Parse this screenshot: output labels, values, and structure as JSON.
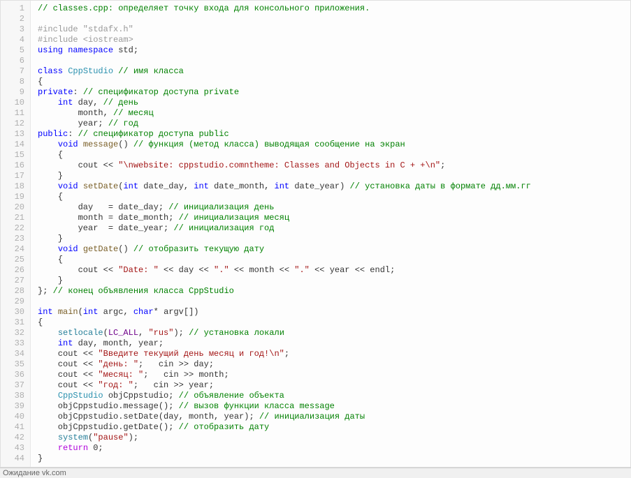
{
  "status_bar": "Ожидание vk.com",
  "lines": [
    [
      {
        "cls": "c-comment",
        "t": "// classes.cpp: определяет точку входа для консольного приложения."
      }
    ],
    [],
    [
      {
        "cls": "c-pp",
        "t": "#include \"stdafx.h\""
      }
    ],
    [
      {
        "cls": "c-pp",
        "t": "#include <iostream>"
      }
    ],
    [
      {
        "cls": "c-keyword",
        "t": "using"
      },
      {
        "cls": "c-plain",
        "t": " "
      },
      {
        "cls": "c-keyword",
        "t": "namespace"
      },
      {
        "cls": "c-plain",
        "t": " std;"
      }
    ],
    [],
    [
      {
        "cls": "c-keyword",
        "t": "class"
      },
      {
        "cls": "c-plain",
        "t": " "
      },
      {
        "cls": "c-type",
        "t": "CppStudio"
      },
      {
        "cls": "c-plain",
        "t": " "
      },
      {
        "cls": "c-comment",
        "t": "// имя класса"
      }
    ],
    [
      {
        "cls": "c-plain",
        "t": "{"
      }
    ],
    [
      {
        "cls": "c-keyword",
        "t": "private"
      },
      {
        "cls": "c-plain",
        "t": ": "
      },
      {
        "cls": "c-comment",
        "t": "// спецификатор доступа private"
      }
    ],
    [
      {
        "cls": "c-plain",
        "t": "    "
      },
      {
        "cls": "c-keyword",
        "t": "int"
      },
      {
        "cls": "c-plain",
        "t": " day, "
      },
      {
        "cls": "c-comment",
        "t": "// день"
      }
    ],
    [
      {
        "cls": "c-plain",
        "t": "        month, "
      },
      {
        "cls": "c-comment",
        "t": "// месяц"
      }
    ],
    [
      {
        "cls": "c-plain",
        "t": "        year; "
      },
      {
        "cls": "c-comment",
        "t": "// год"
      }
    ],
    [
      {
        "cls": "c-keyword",
        "t": "public"
      },
      {
        "cls": "c-plain",
        "t": ": "
      },
      {
        "cls": "c-comment",
        "t": "// спецификатор доступа public"
      }
    ],
    [
      {
        "cls": "c-plain",
        "t": "    "
      },
      {
        "cls": "c-keyword",
        "t": "void"
      },
      {
        "cls": "c-plain",
        "t": " "
      },
      {
        "cls": "c-func",
        "t": "message"
      },
      {
        "cls": "c-plain",
        "t": "() "
      },
      {
        "cls": "c-comment",
        "t": "// функция (метод класса) выводящая сообщение на экран"
      }
    ],
    [
      {
        "cls": "c-plain",
        "t": "    {"
      }
    ],
    [
      {
        "cls": "c-plain",
        "t": "        cout << "
      },
      {
        "cls": "c-string",
        "t": "\"\\nwebsite: cppstudio.comntheme: Classes and Objects in C + +\\n\""
      },
      {
        "cls": "c-plain",
        "t": ";"
      }
    ],
    [
      {
        "cls": "c-plain",
        "t": "    }"
      }
    ],
    [
      {
        "cls": "c-plain",
        "t": "    "
      },
      {
        "cls": "c-keyword",
        "t": "void"
      },
      {
        "cls": "c-plain",
        "t": " "
      },
      {
        "cls": "c-func",
        "t": "setDate"
      },
      {
        "cls": "c-plain",
        "t": "("
      },
      {
        "cls": "c-keyword",
        "t": "int"
      },
      {
        "cls": "c-plain",
        "t": " date_day, "
      },
      {
        "cls": "c-keyword",
        "t": "int"
      },
      {
        "cls": "c-plain",
        "t": " date_month, "
      },
      {
        "cls": "c-keyword",
        "t": "int"
      },
      {
        "cls": "c-plain",
        "t": " date_year) "
      },
      {
        "cls": "c-comment",
        "t": "// установка даты в формате дд.мм.гг"
      }
    ],
    [
      {
        "cls": "c-plain",
        "t": "    {"
      }
    ],
    [
      {
        "cls": "c-plain",
        "t": "        day   = date_day; "
      },
      {
        "cls": "c-comment",
        "t": "// инициализация день"
      }
    ],
    [
      {
        "cls": "c-plain",
        "t": "        month = date_month; "
      },
      {
        "cls": "c-comment",
        "t": "// инициализация месяц"
      }
    ],
    [
      {
        "cls": "c-plain",
        "t": "        year  = date_year; "
      },
      {
        "cls": "c-comment",
        "t": "// инициализация год"
      }
    ],
    [
      {
        "cls": "c-plain",
        "t": "    }"
      }
    ],
    [
      {
        "cls": "c-plain",
        "t": "    "
      },
      {
        "cls": "c-keyword",
        "t": "void"
      },
      {
        "cls": "c-plain",
        "t": " "
      },
      {
        "cls": "c-func",
        "t": "getDate"
      },
      {
        "cls": "c-plain",
        "t": "() "
      },
      {
        "cls": "c-comment",
        "t": "// отобразить текущую дату"
      }
    ],
    [
      {
        "cls": "c-plain",
        "t": "    {"
      }
    ],
    [
      {
        "cls": "c-plain",
        "t": "        cout << "
      },
      {
        "cls": "c-string",
        "t": "\"Date: \""
      },
      {
        "cls": "c-plain",
        "t": " << day << "
      },
      {
        "cls": "c-string",
        "t": "\".\""
      },
      {
        "cls": "c-plain",
        "t": " << month << "
      },
      {
        "cls": "c-string",
        "t": "\".\""
      },
      {
        "cls": "c-plain",
        "t": " << year << endl;"
      }
    ],
    [
      {
        "cls": "c-plain",
        "t": "    }"
      }
    ],
    [
      {
        "cls": "c-plain",
        "t": "}; "
      },
      {
        "cls": "c-comment",
        "t": "// конец объявления класса CppStudio"
      }
    ],
    [],
    [
      {
        "cls": "c-keyword",
        "t": "int"
      },
      {
        "cls": "c-plain",
        "t": " "
      },
      {
        "cls": "c-func",
        "t": "main"
      },
      {
        "cls": "c-plain",
        "t": "("
      },
      {
        "cls": "c-keyword",
        "t": "int"
      },
      {
        "cls": "c-plain",
        "t": " argc, "
      },
      {
        "cls": "c-keyword",
        "t": "char"
      },
      {
        "cls": "c-plain",
        "t": "* argv[])"
      }
    ],
    [
      {
        "cls": "c-plain",
        "t": "{"
      }
    ],
    [
      {
        "cls": "c-plain",
        "t": "    "
      },
      {
        "cls": "c-builtin",
        "t": "setlocale"
      },
      {
        "cls": "c-plain",
        "t": "("
      },
      {
        "cls": "c-macro",
        "t": "LC_ALL"
      },
      {
        "cls": "c-plain",
        "t": ", "
      },
      {
        "cls": "c-string",
        "t": "\"rus\""
      },
      {
        "cls": "c-plain",
        "t": "); "
      },
      {
        "cls": "c-comment",
        "t": "// установка локали"
      }
    ],
    [
      {
        "cls": "c-plain",
        "t": "    "
      },
      {
        "cls": "c-keyword",
        "t": "int"
      },
      {
        "cls": "c-plain",
        "t": " day, month, year;"
      }
    ],
    [
      {
        "cls": "c-plain",
        "t": "    cout << "
      },
      {
        "cls": "c-string",
        "t": "\"Введите текущий день месяц и год!\\n\""
      },
      {
        "cls": "c-plain",
        "t": ";"
      }
    ],
    [
      {
        "cls": "c-plain",
        "t": "    cout << "
      },
      {
        "cls": "c-string",
        "t": "\"день: \""
      },
      {
        "cls": "c-plain",
        "t": ";   cin >> day;"
      }
    ],
    [
      {
        "cls": "c-plain",
        "t": "    cout << "
      },
      {
        "cls": "c-string",
        "t": "\"месяц: \""
      },
      {
        "cls": "c-plain",
        "t": ";   cin >> month;"
      }
    ],
    [
      {
        "cls": "c-plain",
        "t": "    cout << "
      },
      {
        "cls": "c-string",
        "t": "\"год: \""
      },
      {
        "cls": "c-plain",
        "t": ";   cin >> year;"
      }
    ],
    [
      {
        "cls": "c-plain",
        "t": "    "
      },
      {
        "cls": "c-type",
        "t": "CppStudio"
      },
      {
        "cls": "c-plain",
        "t": " objCppstudio; "
      },
      {
        "cls": "c-comment",
        "t": "// объявление объекта"
      }
    ],
    [
      {
        "cls": "c-plain",
        "t": "    objCppstudio.message(); "
      },
      {
        "cls": "c-comment",
        "t": "// вызов функции класса message"
      }
    ],
    [
      {
        "cls": "c-plain",
        "t": "    objCppstudio.setDate(day, month, year); "
      },
      {
        "cls": "c-comment",
        "t": "// инициализация даты"
      }
    ],
    [
      {
        "cls": "c-plain",
        "t": "    objCppstudio.getDate(); "
      },
      {
        "cls": "c-comment",
        "t": "// отобразить дату"
      }
    ],
    [
      {
        "cls": "c-plain",
        "t": "    "
      },
      {
        "cls": "c-builtin",
        "t": "system"
      },
      {
        "cls": "c-plain",
        "t": "("
      },
      {
        "cls": "c-string",
        "t": "\"pause\""
      },
      {
        "cls": "c-plain",
        "t": ");"
      }
    ],
    [
      {
        "cls": "c-plain",
        "t": "    "
      },
      {
        "cls": "c-control",
        "t": "return"
      },
      {
        "cls": "c-plain",
        "t": " 0;"
      }
    ],
    [
      {
        "cls": "c-plain",
        "t": "}"
      }
    ]
  ]
}
